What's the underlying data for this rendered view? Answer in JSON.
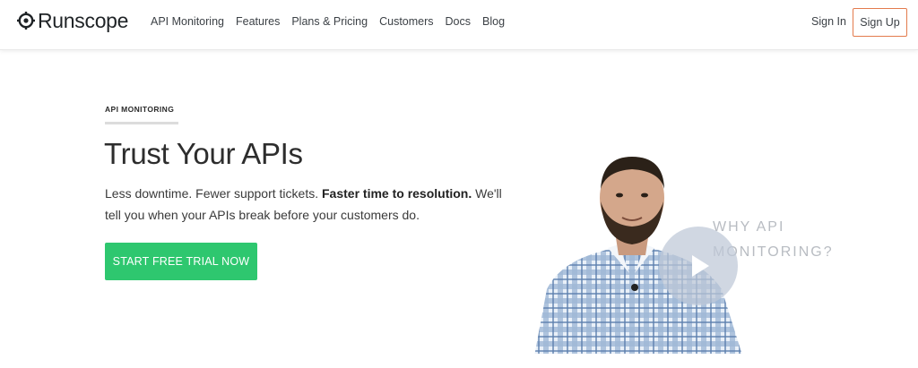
{
  "brand": {
    "name": "Runscope"
  },
  "nav": {
    "items": [
      {
        "label": "API Monitoring"
      },
      {
        "label": "Features"
      },
      {
        "label": "Plans & Pricing"
      },
      {
        "label": "Customers"
      },
      {
        "label": "Docs"
      },
      {
        "label": "Blog"
      }
    ],
    "sign_in": "Sign In",
    "sign_up": "Sign Up"
  },
  "hero": {
    "eyebrow": "API MONITORING",
    "title": "Trust Your APIs",
    "subtitle_lead": "Less downtime. Fewer support tickets.",
    "subtitle_bold": "Faster time to resolution.",
    "subtitle_tail": "We'll tell you when your APIs break before your customers do.",
    "cta": "START FREE TRIAL NOW"
  },
  "video": {
    "title": "WHY API\nMONITORING?"
  },
  "colors": {
    "accent_green": "#2ec76f",
    "signup_border": "#e37b4d",
    "play_overlay": "#bec8d7"
  },
  "icons": {
    "logo": "runscope-logo-icon",
    "play": "play-icon"
  }
}
